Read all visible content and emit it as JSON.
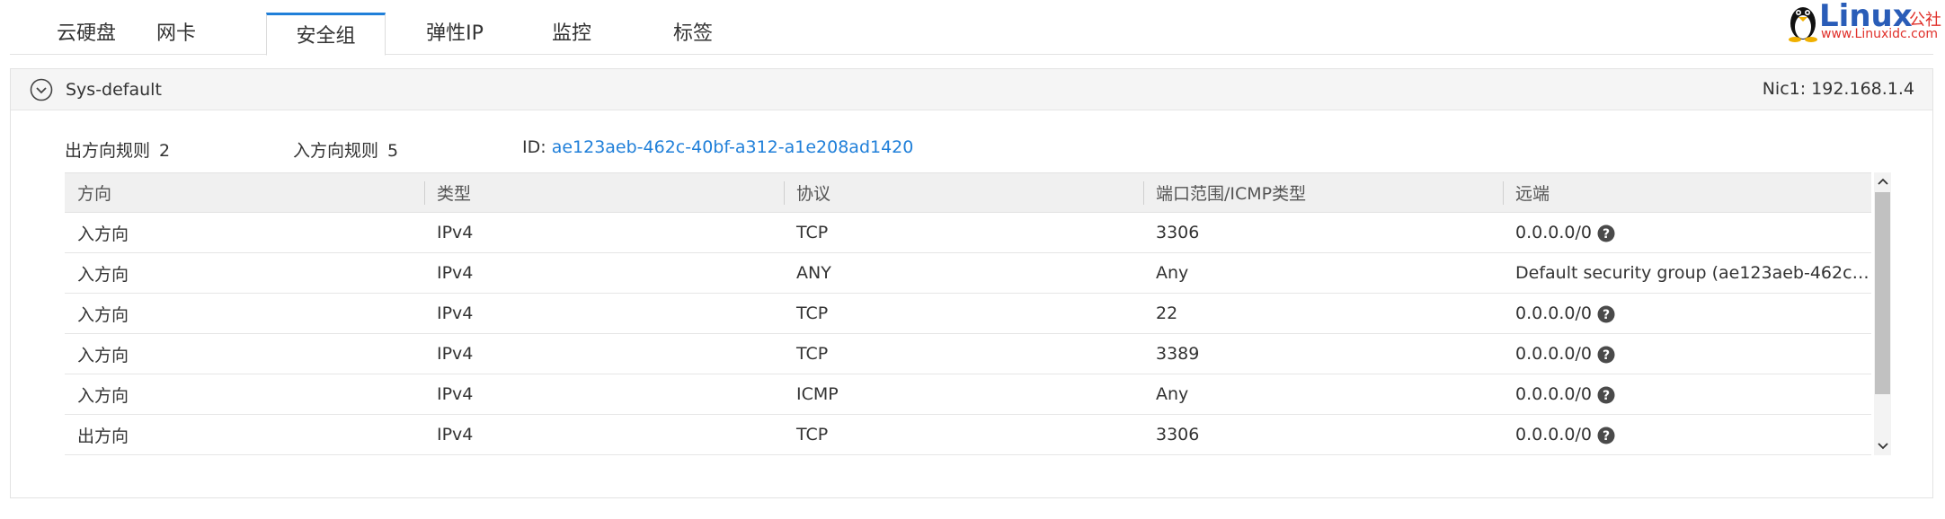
{
  "tabs": [
    {
      "label": "云硬盘",
      "active": false
    },
    {
      "label": "网卡",
      "active": false
    },
    {
      "label": "安全组",
      "active": true
    },
    {
      "label": "弹性IP",
      "active": false
    },
    {
      "label": "监控",
      "active": false
    },
    {
      "label": "标签",
      "active": false
    }
  ],
  "logo": {
    "word": "Linux",
    "cn": "公社",
    "url": "www.Linuxidc.com"
  },
  "panel": {
    "title": "Sys-default",
    "nic_info": "Nic1: 192.168.1.4",
    "outbound_label": "出方向规则",
    "outbound_count": "2",
    "inbound_label": "入方向规则",
    "inbound_count": "5",
    "id_label": "ID:",
    "id_value": "ae123aeb-462c-40bf-a312-a1e208ad1420"
  },
  "table": {
    "columns": [
      "方向",
      "类型",
      "协议",
      "端口范围/ICMP类型",
      "远端"
    ],
    "rows": [
      {
        "direction": "入方向",
        "type": "IPv4",
        "protocol": "TCP",
        "port": "3306",
        "remote": "0.0.0.0/0",
        "help": true
      },
      {
        "direction": "入方向",
        "type": "IPv4",
        "protocol": "ANY",
        "port": "Any",
        "remote": "Default security group (ae123aeb-462c-...",
        "help": false
      },
      {
        "direction": "入方向",
        "type": "IPv4",
        "protocol": "TCP",
        "port": "22",
        "remote": "0.0.0.0/0",
        "help": true
      },
      {
        "direction": "入方向",
        "type": "IPv4",
        "protocol": "TCP",
        "port": "3389",
        "remote": "0.0.0.0/0",
        "help": true
      },
      {
        "direction": "入方向",
        "type": "IPv4",
        "protocol": "ICMP",
        "port": "Any",
        "remote": "0.0.0.0/0",
        "help": true
      },
      {
        "direction": "出方向",
        "type": "IPv4",
        "protocol": "TCP",
        "port": "3306",
        "remote": "0.0.0.0/0",
        "help": true
      }
    ]
  },
  "colors": {
    "accent": "#1f7fd9",
    "header_bg": "#f5f5f5",
    "logo_blue": "#2a5db8",
    "logo_red": "#e0302a"
  },
  "icons": {
    "toggle": "chevron-circle-down-icon",
    "help": "question-circle-icon",
    "scroll_up": "chevron-up-icon",
    "scroll_down": "chevron-down-icon"
  }
}
